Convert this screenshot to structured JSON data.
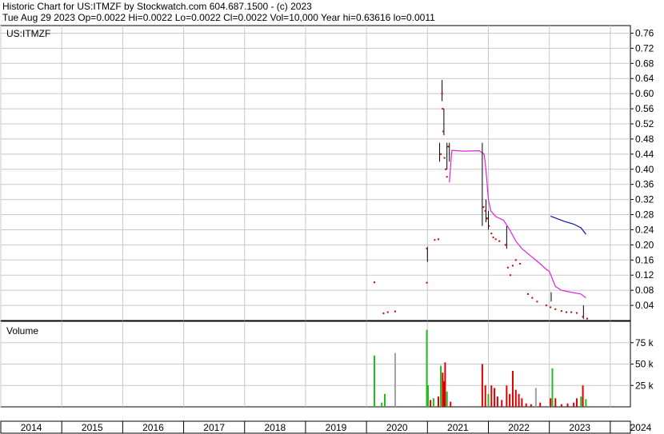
{
  "header": {
    "line1": "Historic Chart for US:ITMZF by Stockwatch.com 604.687.1500 - (c) 2023",
    "line2": "Tue Aug 29 2023   Op=0.0022   Hi=0.0022   Lo=0.0022   Cl=0.0022   Vol=10,000   Year hi=0.63616   lo=0.0011"
  },
  "chart_data": {
    "type": "line",
    "symbol_label": "US:ITMZF",
    "volume_label": "Volume",
    "x_axis": {
      "unit": "year",
      "range": [
        2014,
        2024.33
      ],
      "tick_labels": [
        "2014",
        "2015",
        "2016",
        "2017",
        "2018",
        "2019",
        "2020",
        "2021",
        "2022",
        "2023",
        "2024"
      ]
    },
    "price_axis": {
      "range": [
        0,
        0.78
      ],
      "tick_labels": [
        "0.76",
        "0.72",
        "0.68",
        "0.64",
        "0.60",
        "0.56",
        "0.52",
        "0.48",
        "0.44",
        "0.40",
        "0.36",
        "0.32",
        "0.28",
        "0.24",
        "0.20",
        "0.16",
        "0.12",
        "0.08",
        "0.04"
      ]
    },
    "volume_axis": {
      "range": [
        0,
        100000
      ],
      "tick_labels": [
        "75 k",
        "50 k",
        "25 k"
      ]
    },
    "grid": true,
    "colors": {
      "price": "#cc0000",
      "bar": "#000000",
      "ma_long": "#e020e0",
      "ma_short": "#1010b0",
      "vol_up": "#22bb22",
      "vol_down": "#dd0000",
      "vol_flat": "#a0a0a0",
      "grid": "#c8c8c8"
    },
    "price_points": [
      [
        2020.13,
        0.101
      ],
      [
        2020.28,
        0.019
      ],
      [
        2020.35,
        0.022
      ],
      [
        2020.47,
        0.024
      ],
      [
        2020.99,
        0.1
      ],
      [
        2020.99,
        0.19
      ],
      [
        2021.12,
        0.213
      ],
      [
        2021.18,
        0.215
      ],
      [
        2021.22,
        0.44
      ],
      [
        2021.24,
        0.6
      ],
      [
        2021.25,
        0.56
      ],
      [
        2021.26,
        0.5
      ],
      [
        2021.28,
        0.43
      ],
      [
        2021.3,
        0.4
      ],
      [
        2021.32,
        0.38
      ],
      [
        2021.34,
        0.46
      ],
      [
        2021.92,
        0.3
      ],
      [
        2021.95,
        0.29
      ],
      [
        2021.98,
        0.27
      ],
      [
        2022.01,
        0.25
      ],
      [
        2022.05,
        0.23
      ],
      [
        2022.08,
        0.22
      ],
      [
        2022.12,
        0.215
      ],
      [
        2022.18,
        0.21
      ],
      [
        2022.28,
        0.2
      ],
      [
        2022.32,
        0.14
      ],
      [
        2022.36,
        0.12
      ],
      [
        2022.4,
        0.145
      ],
      [
        2022.45,
        0.16
      ],
      [
        2022.52,
        0.15
      ],
      [
        2022.65,
        0.07
      ],
      [
        2022.72,
        0.06
      ],
      [
        2022.8,
        0.05
      ],
      [
        2022.95,
        0.04
      ],
      [
        2023.02,
        0.035
      ],
      [
        2023.1,
        0.03
      ],
      [
        2023.2,
        0.025
      ],
      [
        2023.28,
        0.022
      ],
      [
        2023.36,
        0.022
      ],
      [
        2023.45,
        0.02
      ],
      [
        2023.55,
        0.01
      ],
      [
        2023.62,
        0.005
      ]
    ],
    "range_bars": [
      [
        2021.0,
        0.155,
        0.195
      ],
      [
        2021.2,
        0.42,
        0.47
      ],
      [
        2021.24,
        0.58,
        0.636
      ],
      [
        2021.27,
        0.49,
        0.56
      ],
      [
        2021.32,
        0.4,
        0.47
      ],
      [
        2021.36,
        0.42,
        0.47
      ],
      [
        2021.9,
        0.25,
        0.47
      ],
      [
        2021.96,
        0.26,
        0.32
      ],
      [
        2022.0,
        0.24,
        0.29
      ],
      [
        2022.3,
        0.19,
        0.25
      ],
      [
        2023.03,
        0.05,
        0.075
      ],
      [
        2023.56,
        0.004,
        0.04
      ]
    ],
    "series": [
      {
        "points": [
          [
            2021.36,
            0.365
          ],
          [
            2021.4,
            0.45
          ],
          [
            2021.6,
            0.448
          ],
          [
            2021.85,
            0.449
          ],
          [
            2021.93,
            0.44
          ],
          [
            2021.96,
            0.4
          ],
          [
            2022.0,
            0.32
          ],
          [
            2022.04,
            0.29
          ],
          [
            2022.12,
            0.275
          ],
          [
            2022.25,
            0.265
          ],
          [
            2022.35,
            0.24
          ],
          [
            2022.45,
            0.21
          ],
          [
            2022.55,
            0.19
          ],
          [
            2022.7,
            0.17
          ],
          [
            2022.85,
            0.15
          ],
          [
            2022.95,
            0.135
          ],
          [
            2023.0,
            0.13
          ],
          [
            2023.05,
            0.11
          ],
          [
            2023.1,
            0.09
          ],
          [
            2023.2,
            0.08
          ],
          [
            2023.35,
            0.075
          ],
          [
            2023.52,
            0.07
          ],
          [
            2023.6,
            0.06
          ]
        ]
      },
      {
        "points": [
          [
            2023.02,
            0.276
          ],
          [
            2023.12,
            0.27
          ],
          [
            2023.25,
            0.262
          ],
          [
            2023.4,
            0.255
          ],
          [
            2023.52,
            0.245
          ],
          [
            2023.6,
            0.228
          ]
        ]
      }
    ],
    "volume_bars": [
      [
        2020.13,
        60000,
        "up"
      ],
      [
        2020.25,
        5000,
        "up"
      ],
      [
        2020.3,
        15000,
        "up"
      ],
      [
        2020.47,
        63000,
        "flat"
      ],
      [
        2020.99,
        90000,
        "up"
      ],
      [
        2021.01,
        25000,
        "up"
      ],
      [
        2021.05,
        8000,
        "down"
      ],
      [
        2021.1,
        10000,
        "up"
      ],
      [
        2021.18,
        12000,
        "down"
      ],
      [
        2021.22,
        48000,
        "up"
      ],
      [
        2021.25,
        40000,
        "down"
      ],
      [
        2021.27,
        30000,
        "down"
      ],
      [
        2021.29,
        52000,
        "down"
      ],
      [
        2021.32,
        18000,
        "up"
      ],
      [
        2021.38,
        6000,
        "down"
      ],
      [
        2021.9,
        50000,
        "down"
      ],
      [
        2021.95,
        25000,
        "down"
      ],
      [
        2022.0,
        15000,
        "up"
      ],
      [
        2022.05,
        25000,
        "down"
      ],
      [
        2022.1,
        22000,
        "down"
      ],
      [
        2022.15,
        12000,
        "down"
      ],
      [
        2022.22,
        8000,
        "down"
      ],
      [
        2022.3,
        25000,
        "down"
      ],
      [
        2022.35,
        15000,
        "down"
      ],
      [
        2022.4,
        42000,
        "down"
      ],
      [
        2022.45,
        20000,
        "down"
      ],
      [
        2022.5,
        15000,
        "down"
      ],
      [
        2022.55,
        10000,
        "down"
      ],
      [
        2022.62,
        4000,
        "down"
      ],
      [
        2022.7,
        3000,
        "down"
      ],
      [
        2022.78,
        22000,
        "flat"
      ],
      [
        2022.85,
        5000,
        "down"
      ],
      [
        2023.02,
        10000,
        "down"
      ],
      [
        2023.05,
        45000,
        "up"
      ],
      [
        2023.1,
        10000,
        "down"
      ],
      [
        2023.2,
        3000,
        "down"
      ],
      [
        2023.3,
        4000,
        "down"
      ],
      [
        2023.4,
        5000,
        "down"
      ],
      [
        2023.45,
        10000,
        "down"
      ],
      [
        2023.52,
        12000,
        "up"
      ],
      [
        2023.55,
        25000,
        "down"
      ],
      [
        2023.6,
        9000,
        "up"
      ]
    ]
  }
}
